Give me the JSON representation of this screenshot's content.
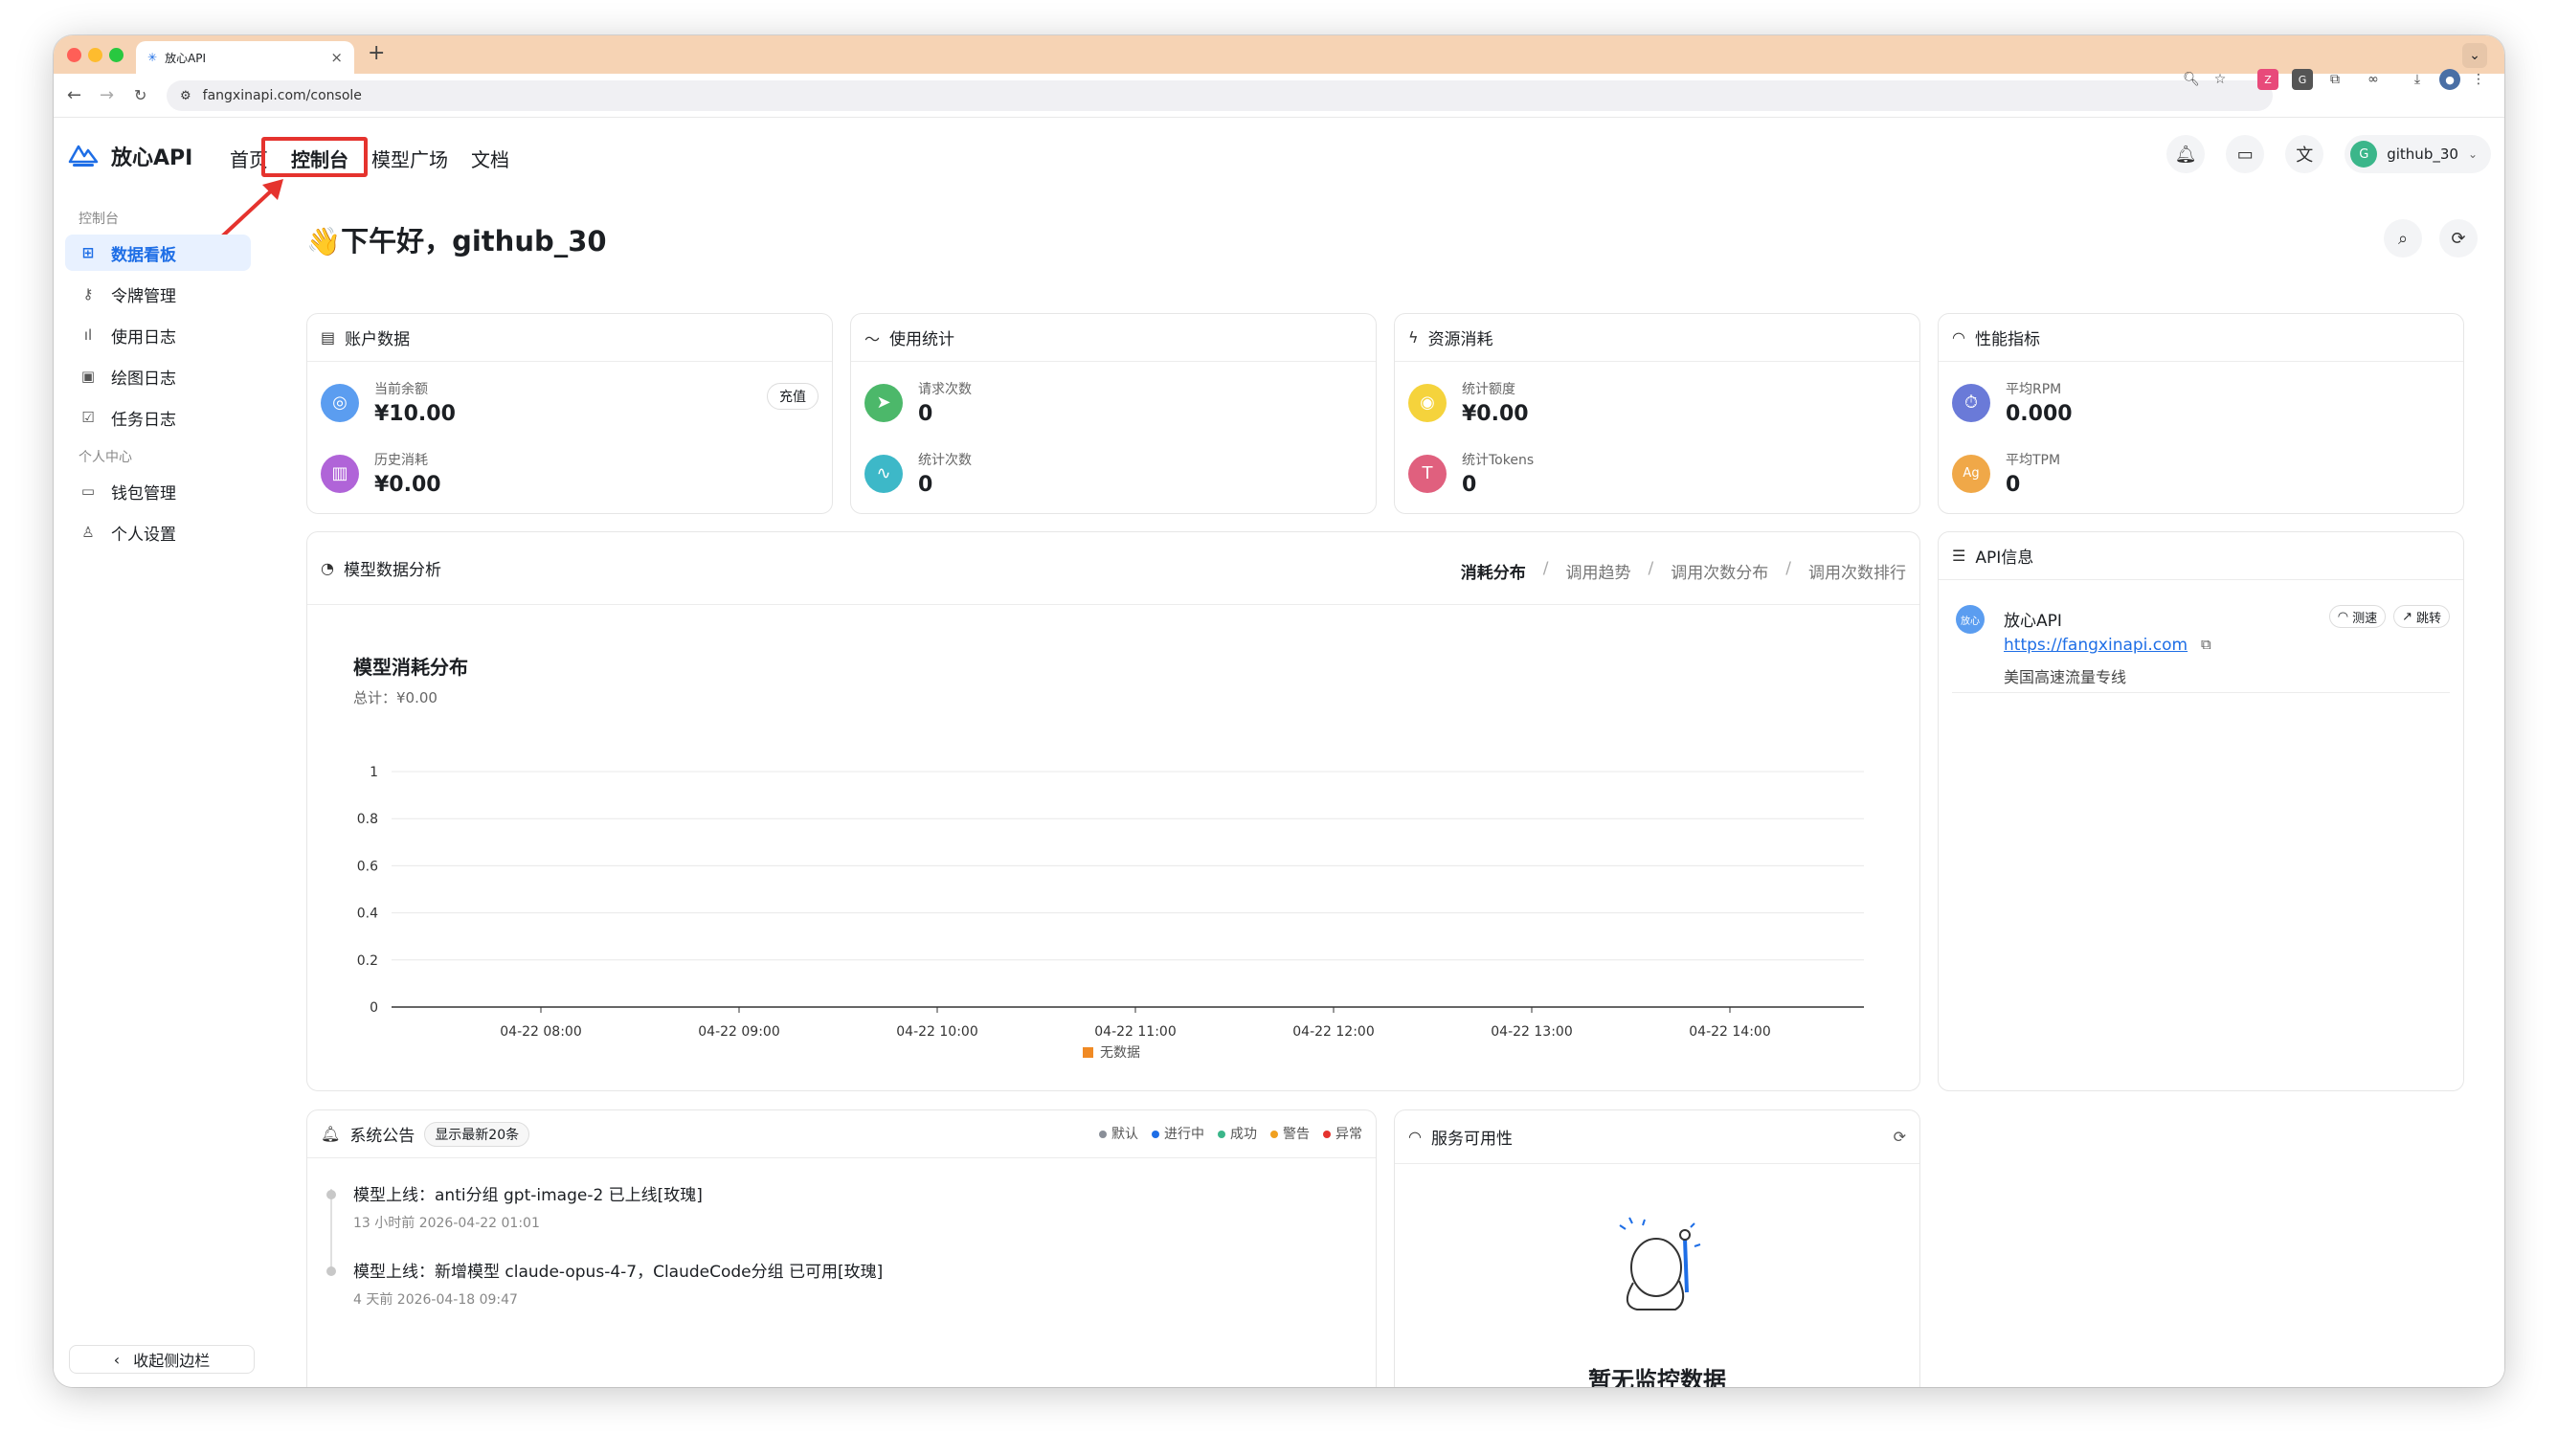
{
  "browser": {
    "tab_title": "放心API",
    "url": "fangxinapi.com/console"
  },
  "header": {
    "brand": "放心API",
    "nav": [
      "首页",
      "控制台",
      "模型广场",
      "文档"
    ],
    "user_initial": "G",
    "username": "github_30"
  },
  "sidebar": {
    "group1": "控制台",
    "items1": [
      "数据看板",
      "令牌管理",
      "使用日志",
      "绘图日志",
      "任务日志"
    ],
    "group2": "个人中心",
    "items2": [
      "钱包管理",
      "个人设置"
    ],
    "collapse": "收起侧边栏"
  },
  "greeting": "👋下午好，github_30",
  "cards": {
    "account": {
      "title": "账户数据",
      "balance_label": "当前余额",
      "balance": "¥10.00",
      "spent_label": "历史消耗",
      "spent": "¥0.00",
      "recharge": "充值"
    },
    "usage": {
      "title": "使用统计",
      "req_label": "请求次数",
      "req": "0",
      "stat_label": "统计次数",
      "stat": "0"
    },
    "resource": {
      "title": "资源消耗",
      "quota_label": "统计额度",
      "quota": "¥0.00",
      "tokens_label": "统计Tokens",
      "tokens": "0"
    },
    "perf": {
      "title": "性能指标",
      "rpm_label": "平均RPM",
      "rpm": "0.000",
      "tpm_label": "平均TPM",
      "tpm": "0"
    }
  },
  "analysis": {
    "title": "模型数据分析",
    "tabs": [
      "消耗分布",
      "调用趋势",
      "调用次数分布",
      "调用次数排行"
    ]
  },
  "chart_data": {
    "type": "bar",
    "title": "模型消耗分布",
    "subtitle": "总计：¥0.00",
    "categories": [
      "04-22 08:00",
      "04-22 09:00",
      "04-22 10:00",
      "04-22 11:00",
      "04-22 12:00",
      "04-22 13:00",
      "04-22 14:00"
    ],
    "yticks": [
      "0",
      "0.2",
      "0.4",
      "0.6",
      "0.8",
      "1"
    ],
    "ylim": [
      0,
      1
    ],
    "series": [
      {
        "name": "无数据",
        "values": [
          0,
          0,
          0,
          0,
          0,
          0,
          0
        ]
      }
    ],
    "legend_color": "#f08a24",
    "grid": true,
    "legend": "bottom"
  },
  "api_info": {
    "title": "API信息",
    "avatar": "放心",
    "name": "放心API",
    "url": "https://fangxinapi.com",
    "desc": "美国高速流量专线",
    "speed": "测速",
    "jump": "跳转"
  },
  "announcements": {
    "title": "系统公告",
    "badge": "显示最新20条",
    "legend": [
      {
        "label": "默认",
        "color": "#8a8f98"
      },
      {
        "label": "进行中",
        "color": "#1e6ee6"
      },
      {
        "label": "成功",
        "color": "#3bb68a"
      },
      {
        "label": "警告",
        "color": "#f0a020"
      },
      {
        "label": "异常",
        "color": "#e5332e"
      }
    ],
    "items": [
      {
        "text": "模型上线：anti分组 gpt-image-2 已上线[玫瑰]",
        "meta": "13 小时前 2026-04-22 01:01"
      },
      {
        "text": "模型上线：新增模型 claude-opus-4-7，ClaudeCode分组 已可用[玫瑰]",
        "meta": "4 天前 2026-04-18 09:47"
      }
    ]
  },
  "service": {
    "title": "服务可用性",
    "empty": "暂无监控数据"
  }
}
